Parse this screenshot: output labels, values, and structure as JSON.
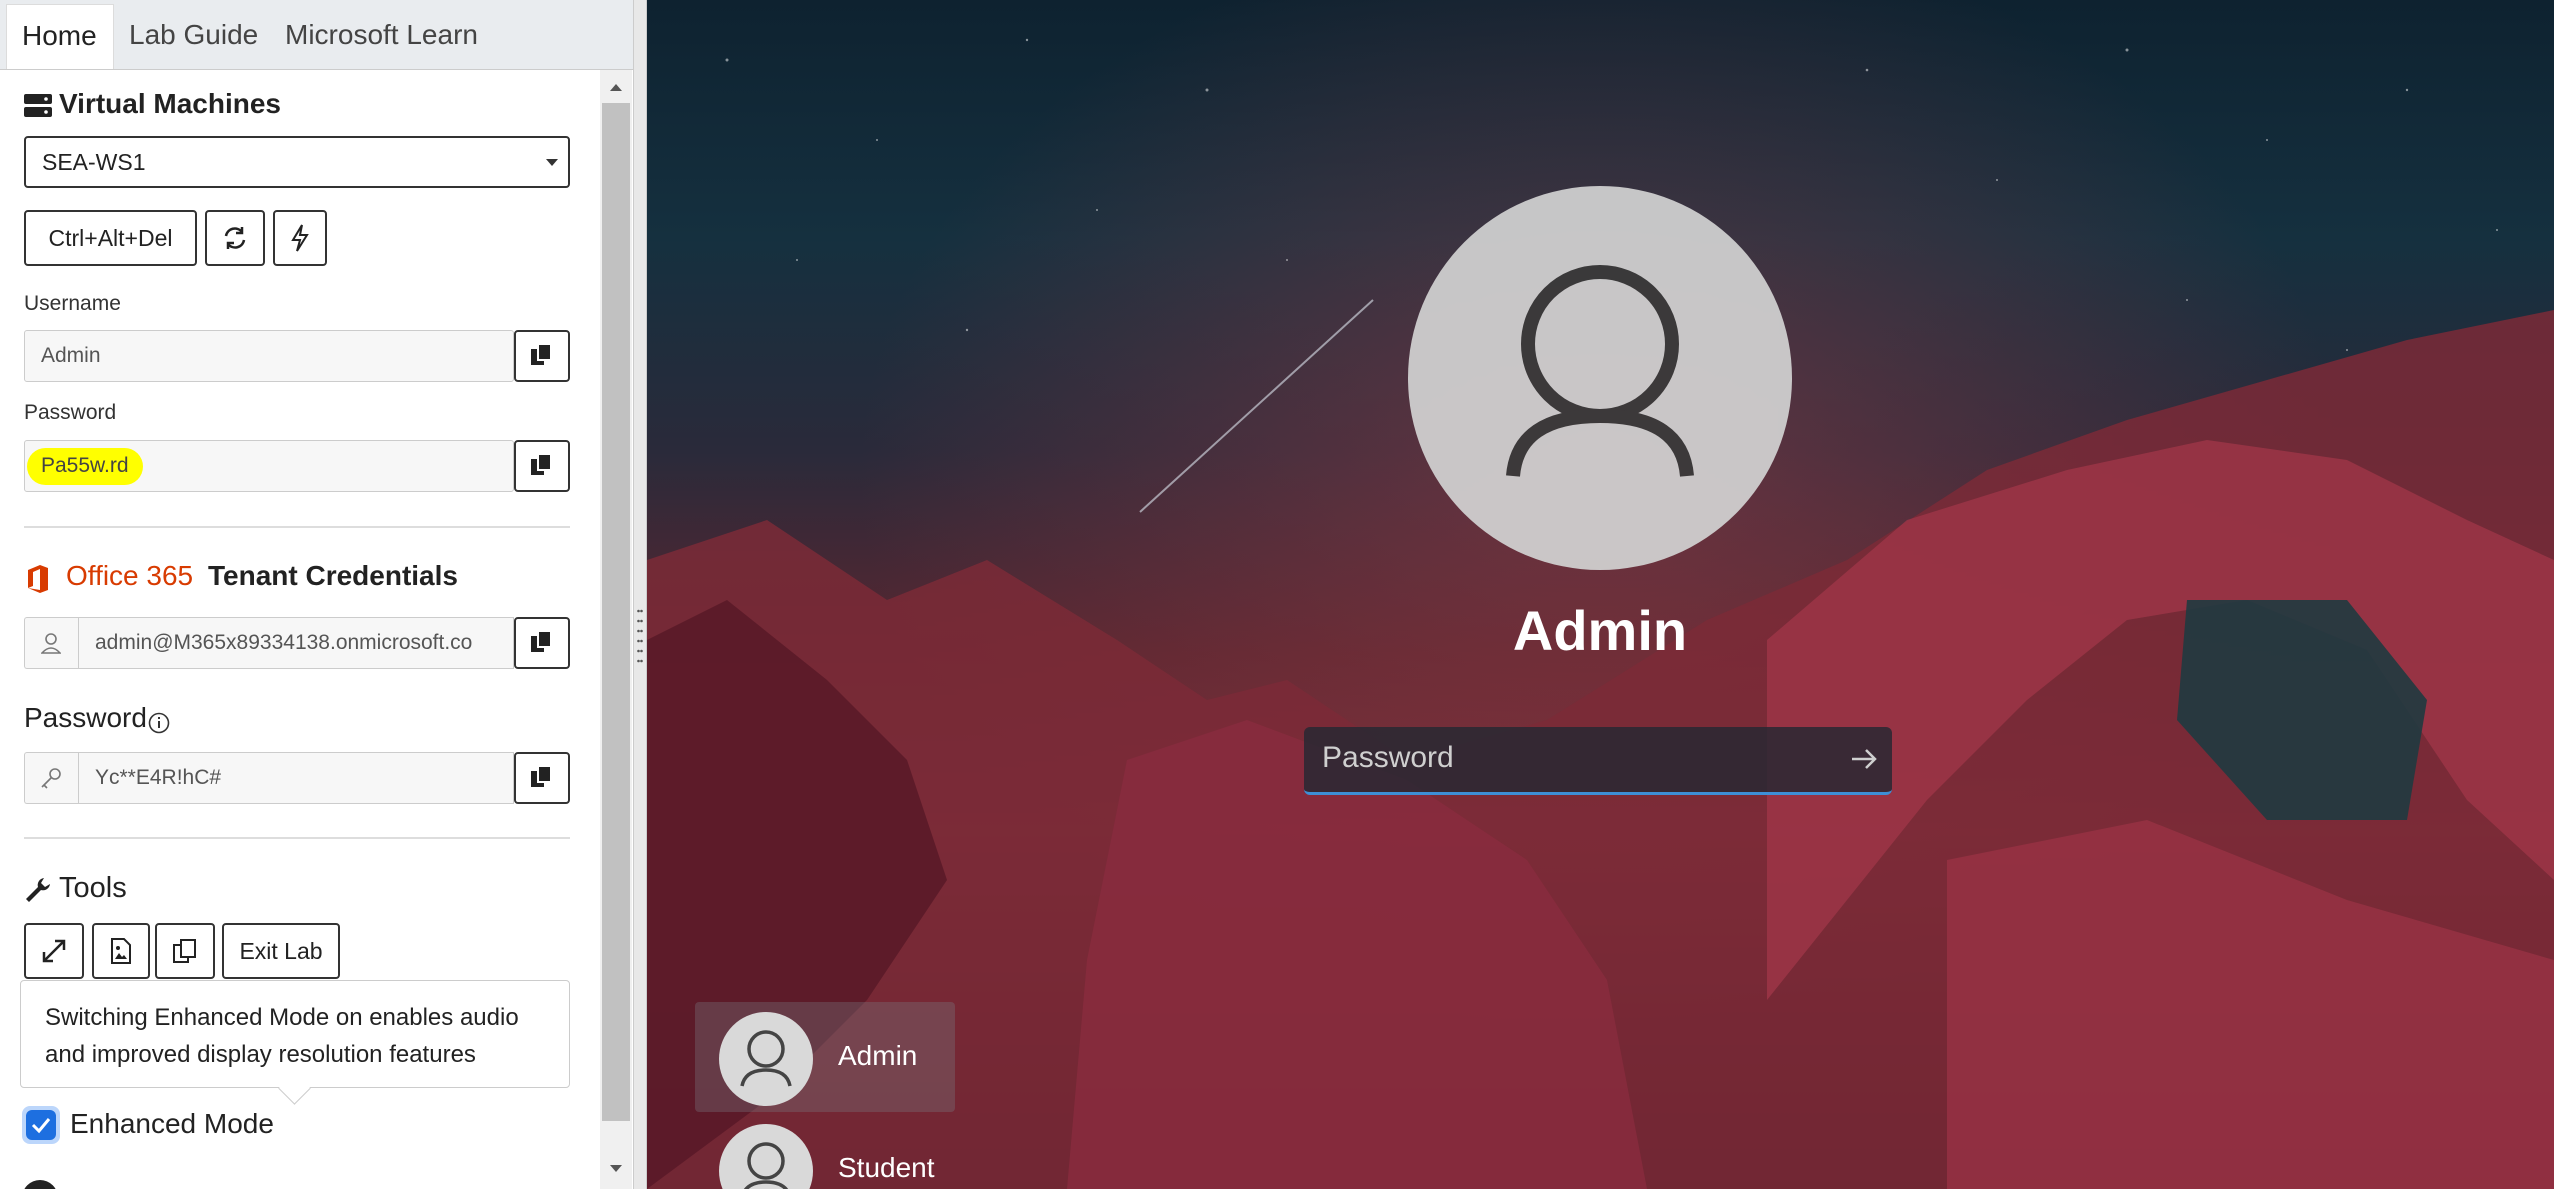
{
  "tabs": [
    "Home",
    "Lab Guide",
    "Microsoft Learn"
  ],
  "vm_section": {
    "title": "Virtual Machines",
    "selected_vm": "SEA-WS1",
    "ctrl_alt_del_label": "Ctrl+Alt+Del",
    "username_label": "Username",
    "username_value": "Admin",
    "password_label": "Password",
    "password_value": "Pa55w.rd"
  },
  "tenant": {
    "brand": "Office 365",
    "title": "Tenant Credentials",
    "username_value": "admin@M365x89334138.onmicrosoft.co",
    "password_label": "Password",
    "password_value": "Yc**E4R!hC#"
  },
  "tools": {
    "title": "Tools",
    "exit_label": "Exit Lab",
    "tooltip": "Switching Enhanced Mode on enables audio and improved display resolution features",
    "enhanced_mode_label": "Enhanced Mode",
    "enhanced_mode_checked": true
  },
  "vm_screen": {
    "user_name": "Admin",
    "password_placeholder": "Password",
    "users": [
      "Admin",
      "Student"
    ]
  },
  "colors": {
    "office_brand": "#d83b01",
    "highlight": "#ffff00",
    "checkbox": "#1d6fe0",
    "focus_underline": "#3d8fd6"
  }
}
